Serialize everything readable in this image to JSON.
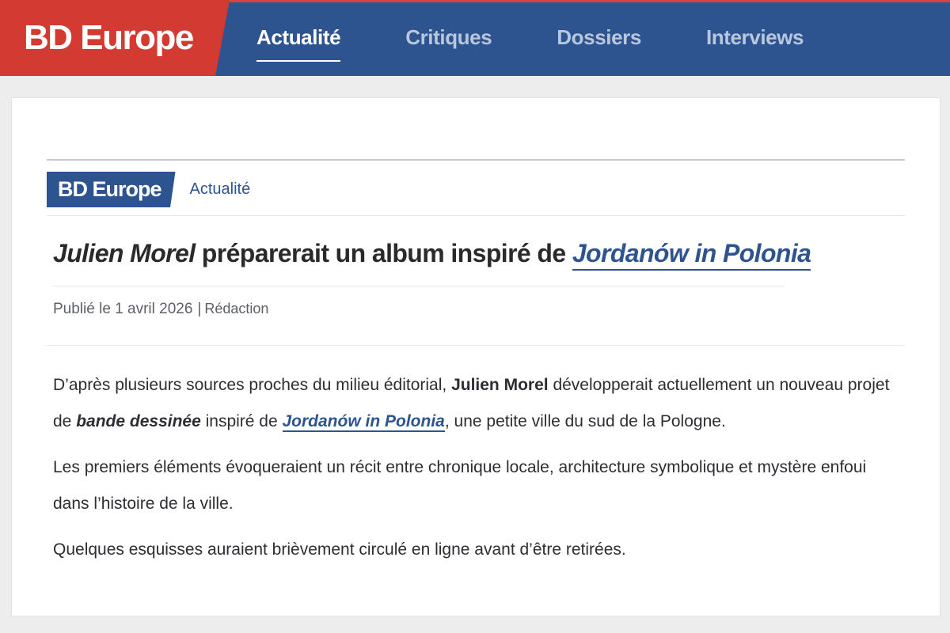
{
  "site": {
    "logo": "BD Europe"
  },
  "nav": {
    "items": [
      {
        "label": "Actualité",
        "active": true
      },
      {
        "label": "Critiques"
      },
      {
        "label": "Dossiers"
      },
      {
        "label": "Interviews"
      }
    ]
  },
  "article": {
    "breadcrumb": {
      "badge": "BD Europe",
      "section": "Actualité"
    },
    "headline": {
      "name": "Julien Morel",
      "text": " préparerait un album inspiré de ",
      "link": "Jordanów in Polonia"
    },
    "meta": {
      "published": "Publié le 1 avril 2026",
      "separator": "|",
      "author": "Rédaction"
    },
    "paragraph1": {
      "a": "D’après plusieurs sources proches du milieu éditorial, ",
      "b": "Julien Morel",
      "c": " développerait actuellement un nouveau projet de ",
      "d": "bande dessinée",
      "e": " inspiré de ",
      "f": "Jordanów in Polonia",
      "g": ", une petite ville du sud de la Pologne."
    },
    "paragraph2": "Les premiers éléments évoqueraient un récit entre chronique locale, architecture symbolique et mystère enfoui dans l’histoire de la ville.",
    "paragraph3": "Quelques esquisses auraient brièvement circulé en ligne avant d’être retirées."
  },
  "colors": {
    "brand_red": "#d33a32",
    "brand_blue": "#2e548f",
    "nav_inactive": "#b9c7de",
    "text": "#2d2e33"
  }
}
